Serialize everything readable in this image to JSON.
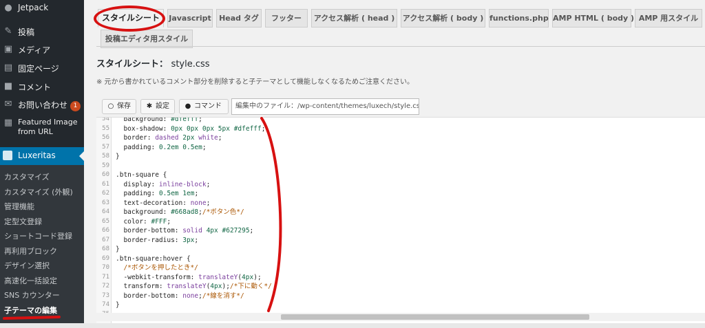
{
  "sidebar": {
    "top_items": [
      {
        "label": "Jetpack",
        "icon": "jetpack-icon",
        "glyph": "●"
      },
      {
        "label": "投稿",
        "icon": "pin-icon",
        "glyph": "✎"
      },
      {
        "label": "メディア",
        "icon": "media-icon",
        "glyph": "▣"
      },
      {
        "label": "固定ページ",
        "icon": "page-icon",
        "glyph": "▤"
      },
      {
        "label": "コメント",
        "icon": "comment-icon",
        "glyph": "■"
      },
      {
        "label": "お問い合わせ",
        "icon": "mail-icon",
        "glyph": "✉",
        "badge": "1"
      },
      {
        "label_line1": "Featured Image",
        "label_line2": "from URL",
        "icon": "image-icon",
        "glyph": "▦"
      }
    ],
    "active_item": "Luxeritas",
    "sub_items": [
      "カスタマイズ",
      "カスタマイズ (外観)",
      "管理機能",
      "定型文登録",
      "ショートコード登録",
      "再利用ブロック",
      "デザイン選択",
      "高速化一括設定",
      "SNS カウンター",
      "子テーマの編集"
    ]
  },
  "tabs": [
    "スタイルシート",
    "Javascript",
    "Head タグ",
    "フッター",
    "アクセス解析 ( head )",
    "アクセス解析 ( body )",
    "functions.php",
    "AMP HTML ( body )",
    "AMP 用スタイル",
    "投稿エディタ用スタイル"
  ],
  "page_title": "スタイルシート：",
  "file_name": "style.css",
  "notice": "※ 元から書かれているコメント部分を削除すると子テーマとして機能しなくなるためご注意ください。",
  "toolbar": {
    "save": "保存",
    "settings": "設定",
    "command": "コマンド"
  },
  "file_path": "編集中のファイル：/wp-content/themes/luxech/style.css",
  "code_lines": [
    {
      "n": "54",
      "t": "  background: #dfefff;"
    },
    {
      "n": "55",
      "t": "  box-shadow: 0px 0px 0px 5px #dfefff;"
    },
    {
      "n": "56",
      "t": "  border: dashed 2px white;"
    },
    {
      "n": "57",
      "t": "  padding: 0.2em 0.5em;"
    },
    {
      "n": "58",
      "t": "}"
    },
    {
      "n": "59",
      "t": ""
    },
    {
      "n": "60",
      "t": ".btn-square {"
    },
    {
      "n": "61",
      "t": "  display: inline-block;"
    },
    {
      "n": "62",
      "t": "  padding: 0.5em 1em;"
    },
    {
      "n": "63",
      "t": "  text-decoration: none;"
    },
    {
      "n": "64",
      "t": "  background: #668ad8;/*ボタン色*/"
    },
    {
      "n": "65",
      "t": "  color: #FFF;"
    },
    {
      "n": "66",
      "t": "  border-bottom: solid 4px #627295;"
    },
    {
      "n": "67",
      "t": "  border-radius: 3px;"
    },
    {
      "n": "68",
      "t": "}"
    },
    {
      "n": "69",
      "t": ".btn-square:hover {"
    },
    {
      "n": "70",
      "t": "  /*ボタンを押したとき*/"
    },
    {
      "n": "71",
      "t": "  -webkit-transform: translateY(4px);"
    },
    {
      "n": "72",
      "t": "  transform: translateY(4px);/*下に動く*/"
    },
    {
      "n": "73",
      "t": "  border-bottom: none;/*線を消す*/"
    },
    {
      "n": "74",
      "t": "}"
    },
    {
      "n": "75",
      "t": ""
    }
  ],
  "colors": {
    "sidebar_bg": "#23282d",
    "active": "#0073aa",
    "annotation": "#d71111"
  }
}
